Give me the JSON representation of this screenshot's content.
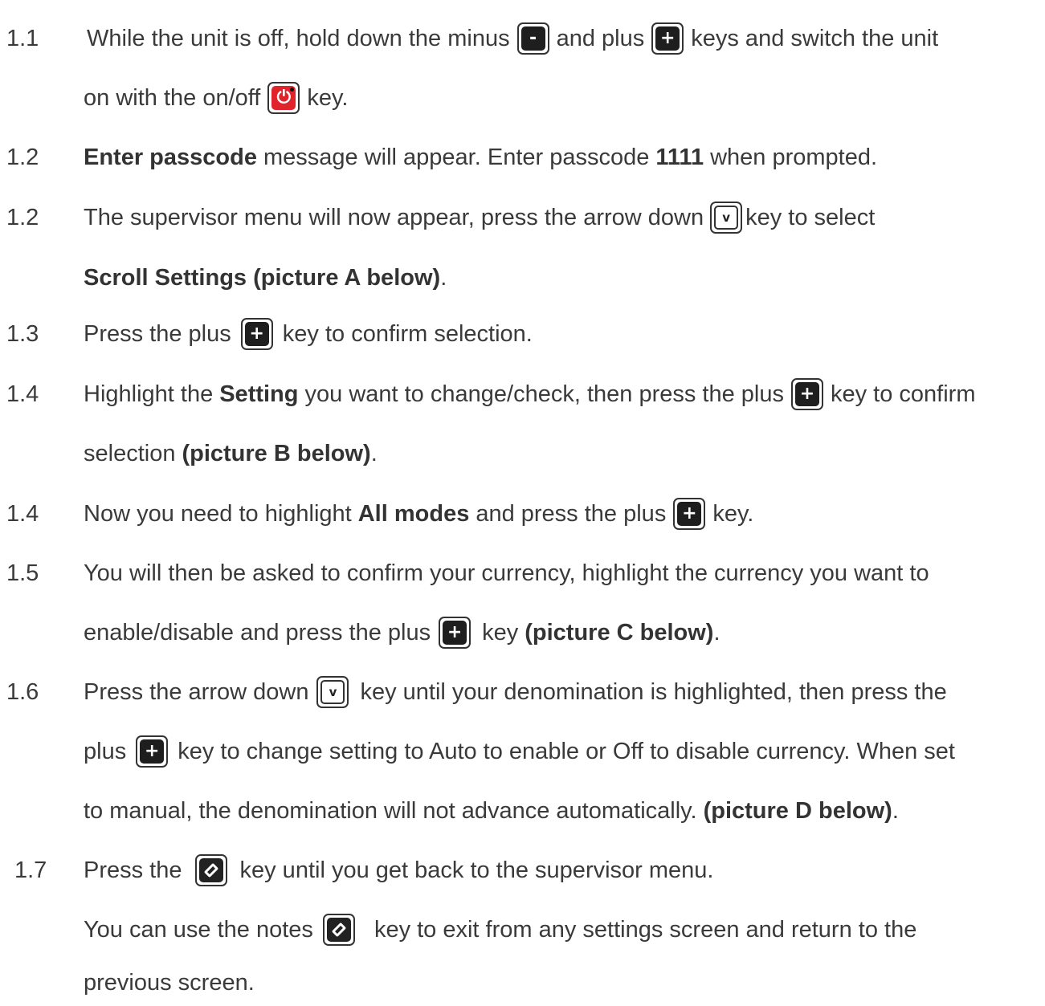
{
  "steps": [
    {
      "num": "1.1",
      "parts": [
        "While the unit is off, hold down the minus",
        "and plus",
        "keys and switch the unit"
      ]
    },
    {
      "parts": [
        "on with the on/off",
        "key."
      ]
    },
    {
      "num": "1.2",
      "bold1": "Enter passcode",
      "t1": "message will appear. Enter passcode",
      "bold2": "1111",
      "t2": "when prompted."
    },
    {
      "num": "1.2",
      "parts": [
        "The supervisor menu will now appear, press the arrow down",
        "key to select"
      ]
    },
    {
      "bold": "Scroll Settings (picture A below)",
      "tail": "."
    },
    {
      "num": "1.3",
      "parts": [
        "Press the plus",
        "key to confirm selection."
      ]
    },
    {
      "num": "1.4",
      "t1": "Highlight the",
      "bold": "Setting",
      "t2": "you want to change/check, then press the plus",
      "t3": "key to confirm"
    },
    {
      "t1": "selection",
      "bold": "(picture B below)",
      "tail": "."
    },
    {
      "num": "1.4",
      "t1": "Now you need to highlight",
      "bold": "All modes",
      "t2": "and press the plus",
      "t3": "key."
    },
    {
      "num": "1.5",
      "text": "You will then be asked to confirm your currency, highlight the currency you want to"
    },
    {
      "t1": "enable/disable and press the plus",
      "t2": "key",
      "bold": "(picture C below)",
      "tail": "."
    },
    {
      "num": "1.6",
      "parts": [
        "Press the arrow down",
        "key until your denomination is highlighted, then press the"
      ]
    },
    {
      "parts": [
        "plus",
        "key to change setting to Auto to enable or Off to disable currency. When set"
      ]
    },
    {
      "t1": "to manual, the denomination will not advance automatically.",
      "bold": "(picture D below)",
      "tail": "."
    },
    {
      "num": "1.7",
      "parts": [
        "Press the",
        "key until you get back to the supervisor menu."
      ]
    },
    {
      "parts": [
        "You can use the notes",
        "key to exit from any settings screen and return to the"
      ]
    },
    {
      "text": "previous screen."
    }
  ],
  "keys": {
    "minus": "-",
    "plus": "+",
    "down": "v"
  },
  "colors": {
    "text": "#3a3a3a",
    "power_key": "#e0242c",
    "key": "#1e1e1e"
  }
}
